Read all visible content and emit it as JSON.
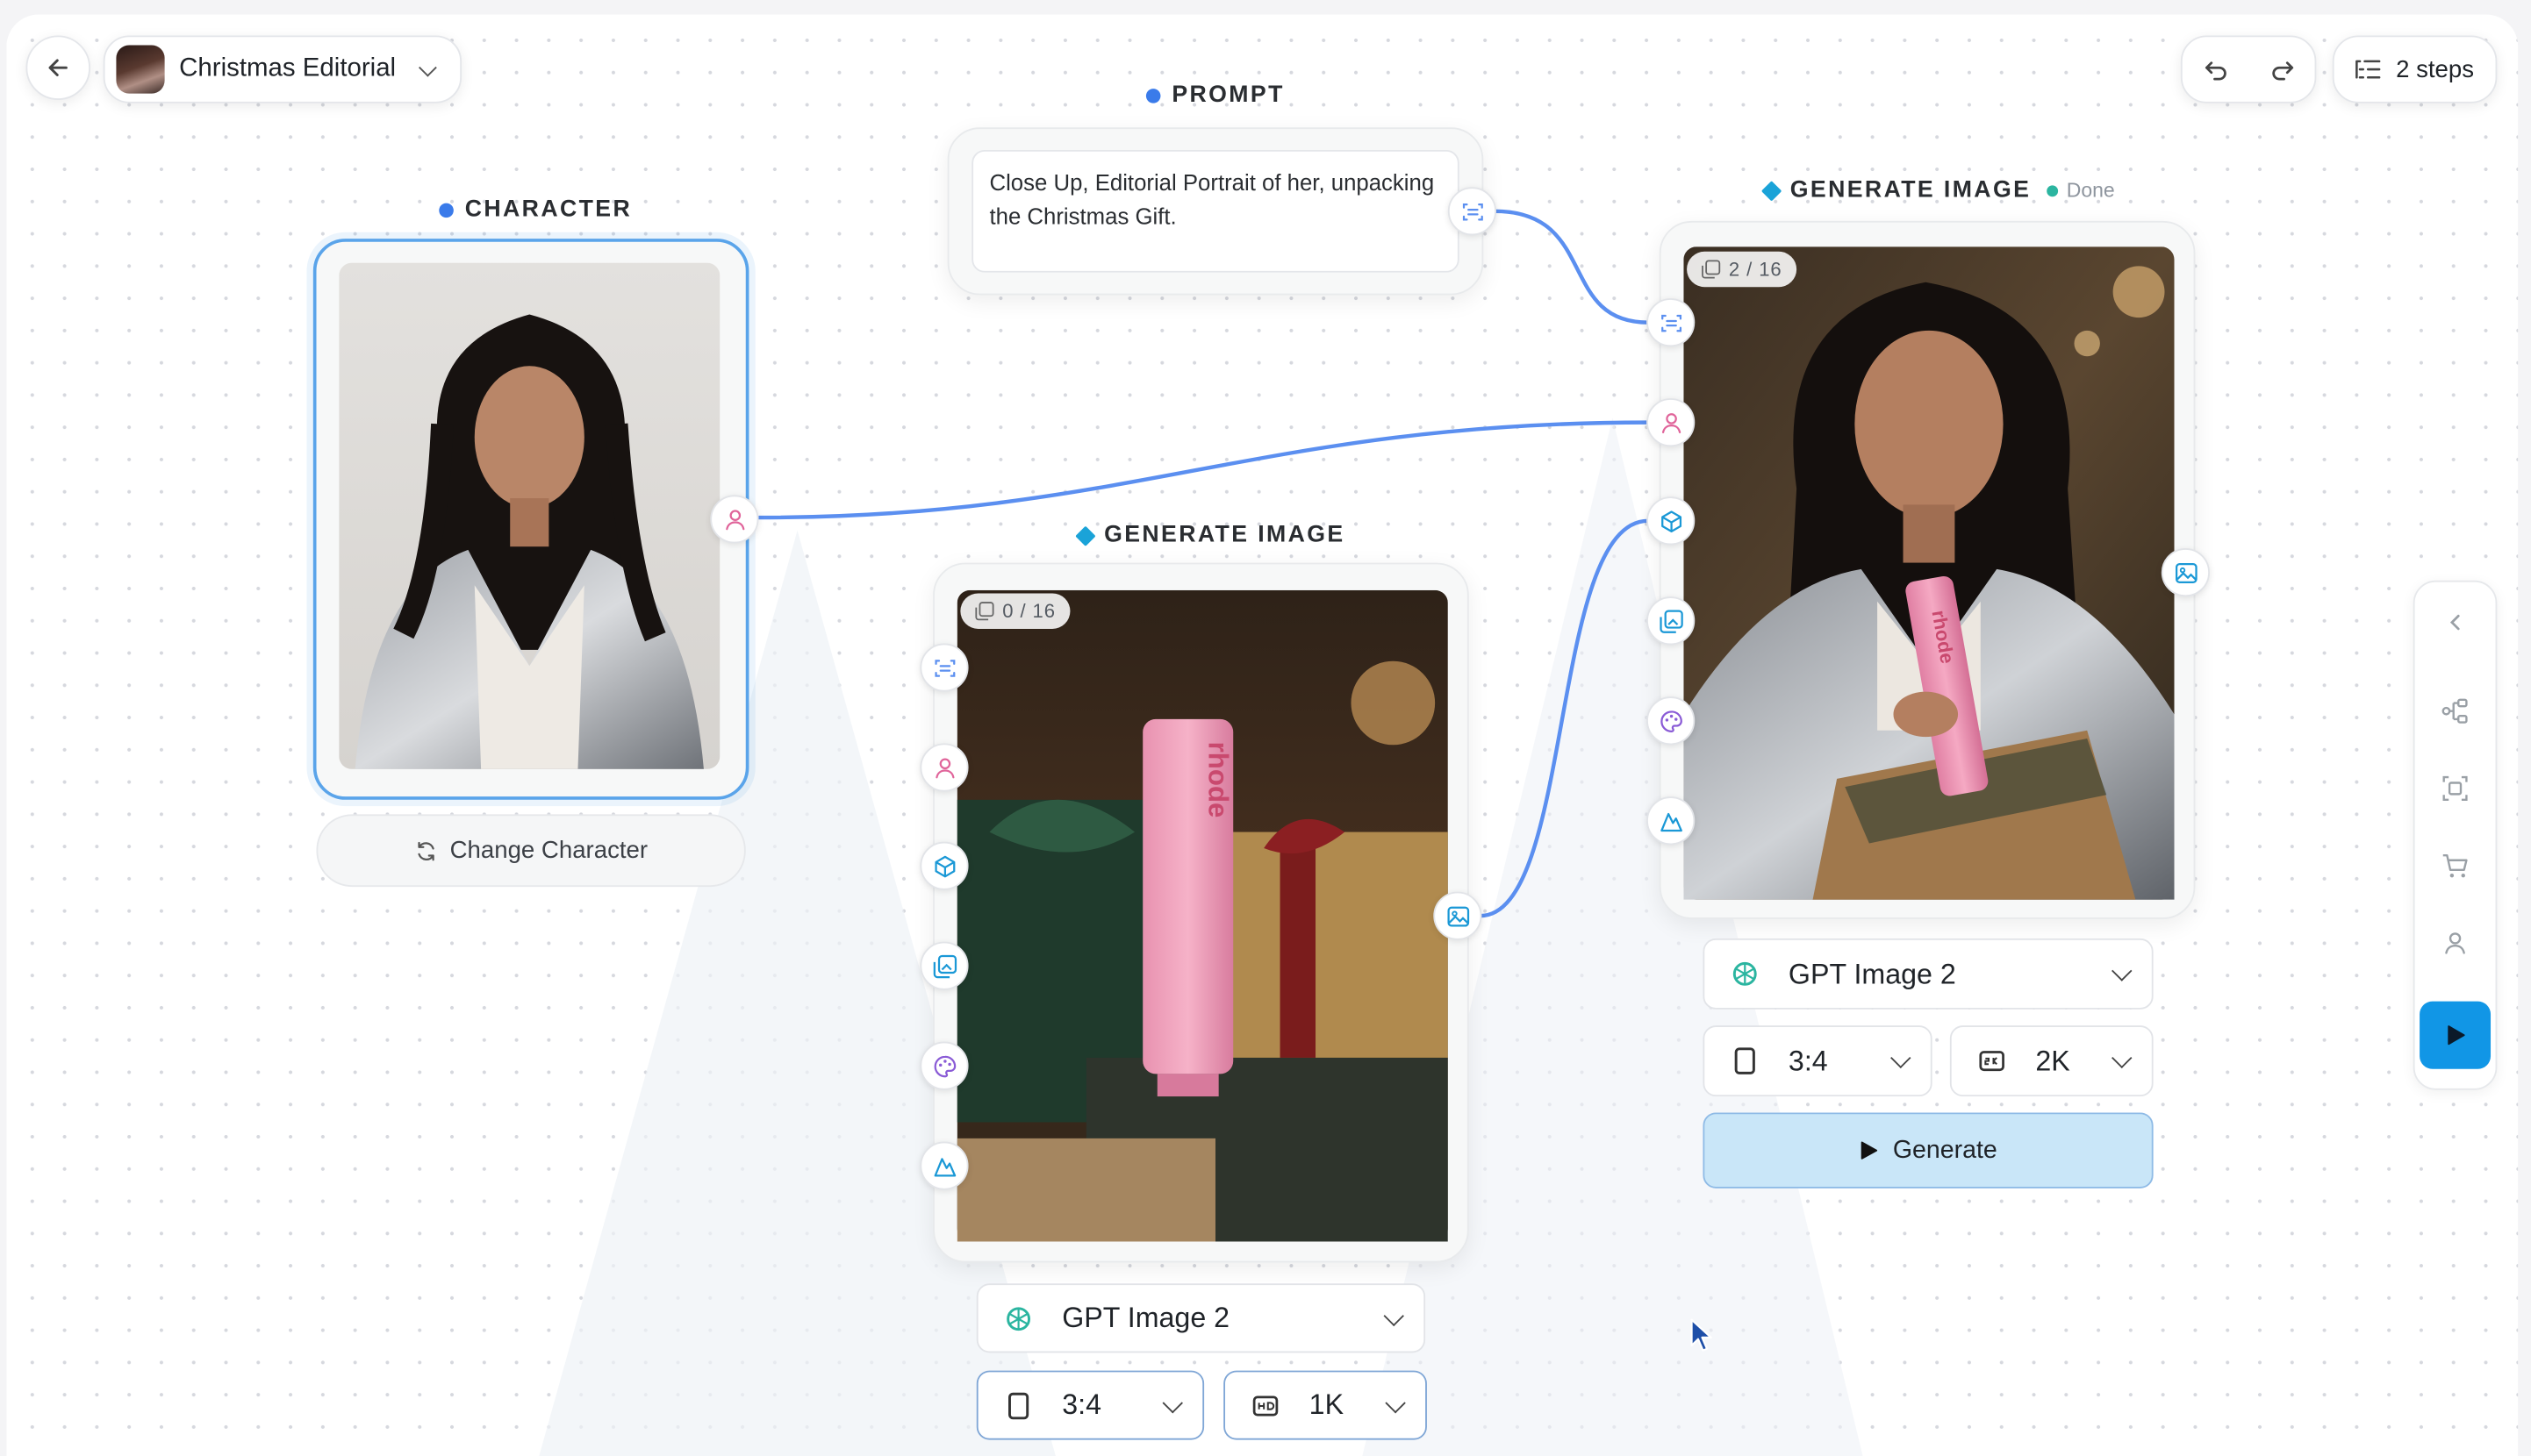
{
  "header": {
    "project_title": "Christmas Editorial",
    "steps_label": "2 steps"
  },
  "character_node": {
    "label": "CHARACTER",
    "change_button": "Change Character"
  },
  "prompt_node": {
    "label": "PROMPT",
    "text": "Close Up, Editorial Portrait of her, unpacking the Christmas Gift."
  },
  "generate_node_1": {
    "label": "GENERATE IMAGE",
    "counter": "0 / 16",
    "model": "GPT Image 2",
    "aspect": "3:4",
    "resolution": "1K",
    "product_text": "rhode"
  },
  "generate_node_2": {
    "label": "GENERATE IMAGE",
    "status": "Done",
    "counter": "2 / 16",
    "model": "GPT Image 2",
    "aspect": "3:4",
    "resolution": "2K",
    "generate_button": "Generate",
    "product_text": "rhode"
  },
  "icons": {
    "back": "arrow-left-icon",
    "undo": "undo-icon",
    "redo": "redo-icon",
    "steps": "list-icon",
    "prompt_port": "text-scan-icon",
    "character_port": "person-icon",
    "object_port": "cube-icon",
    "image_port": "images-icon",
    "style_port": "palette-icon",
    "scene_port": "mountain-icon",
    "output_port": "image-icon",
    "model": "openai-logo-icon",
    "aspect": "portrait-frame-icon",
    "resolution_1": "hd-icon",
    "resolution_2": "2k-icon",
    "refresh": "refresh-icon",
    "play": "play-icon"
  },
  "colors": {
    "connector": "#5b8ff0",
    "character_dot": "#3a7bea",
    "generate_diamond": "#1aa3d8",
    "done": "#2bb5a0",
    "generate_button_bg": "#c9e6f8",
    "run_button_bg": "#1196e6",
    "person_port": "#e0649a",
    "cube_port": "#1a98d6",
    "palette_port": "#8a5bd6"
  }
}
